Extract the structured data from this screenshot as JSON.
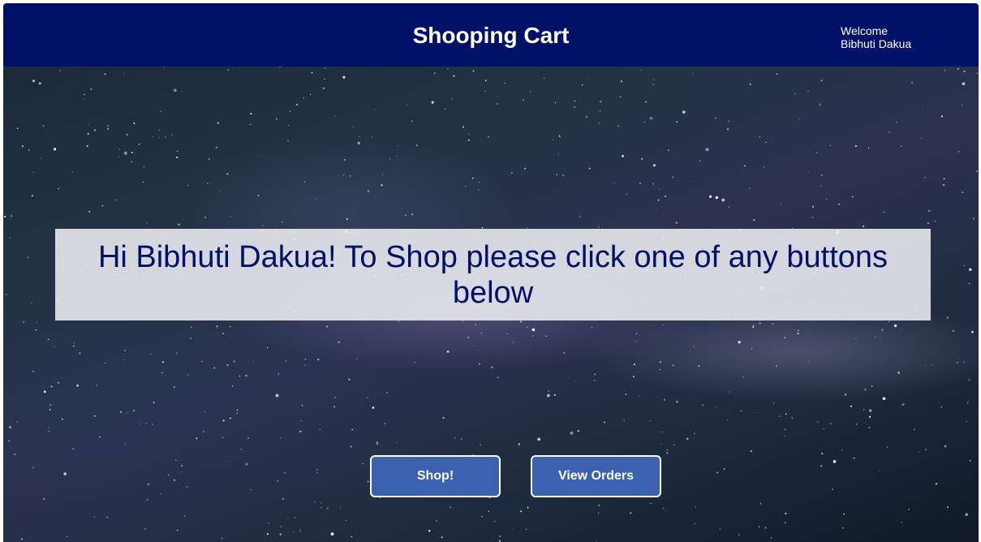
{
  "header": {
    "title": "Shooping Cart",
    "welcome_line1": "Welcome",
    "welcome_line2": "Bibhuti Dakua"
  },
  "main": {
    "message": "Hi Bibhuti Dakua! To Shop please click one of any buttons below"
  },
  "buttons": {
    "shop_label": "Shop!",
    "view_orders_label": "View Orders"
  },
  "colors": {
    "header_bg": "#011167",
    "message_text": "#011167",
    "button_bg": "#3A62AF",
    "button_border": "#FFFFFF"
  }
}
